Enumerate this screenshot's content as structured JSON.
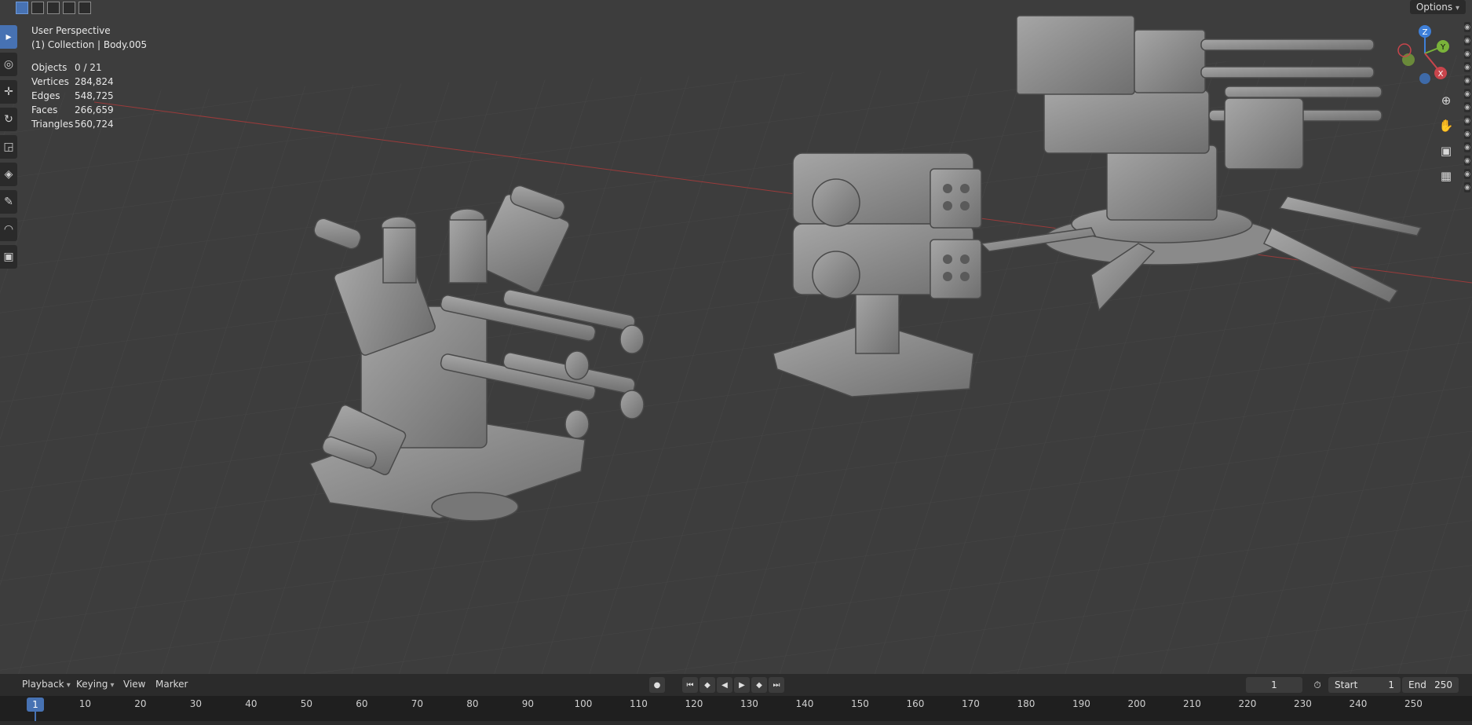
{
  "viewport": {
    "view_name": "User Perspective",
    "collection_label": "(1) Collection | Body.005",
    "options_label": "Options",
    "stats": [
      {
        "label": "Objects",
        "value": "0 / 21"
      },
      {
        "label": "Vertices",
        "value": "284,824"
      },
      {
        "label": "Edges",
        "value": "548,725"
      },
      {
        "label": "Faces",
        "value": "266,659"
      },
      {
        "label": "Triangles",
        "value": "560,724"
      }
    ],
    "gizmo": {
      "x": "X",
      "y": "Y",
      "z": "Z"
    },
    "colors": {
      "x_axis": "#c8454c",
      "y_axis": "#7ab33a",
      "z_axis": "#3e7fd8",
      "accent": "#4772b3"
    }
  },
  "toolbar_icons": [
    "select-box-icon",
    "cursor-icon",
    "move-icon",
    "rotate-icon",
    "scale-icon",
    "transform-icon",
    "annotate-icon",
    "measure-icon",
    "add-cube-icon"
  ],
  "timeline": {
    "menus": {
      "playback": "Playback",
      "keying": "Keying",
      "view": "View",
      "marker": "Marker"
    },
    "current_frame": "1",
    "start_label": "Start",
    "start_value": "1",
    "end_label": "End",
    "end_value": "250",
    "ticks": [
      "1",
      "10",
      "20",
      "30",
      "40",
      "50",
      "60",
      "70",
      "80",
      "90",
      "100",
      "110",
      "120",
      "130",
      "140",
      "150",
      "160",
      "170",
      "180",
      "190",
      "200",
      "210",
      "220",
      "230",
      "240",
      "250"
    ]
  }
}
